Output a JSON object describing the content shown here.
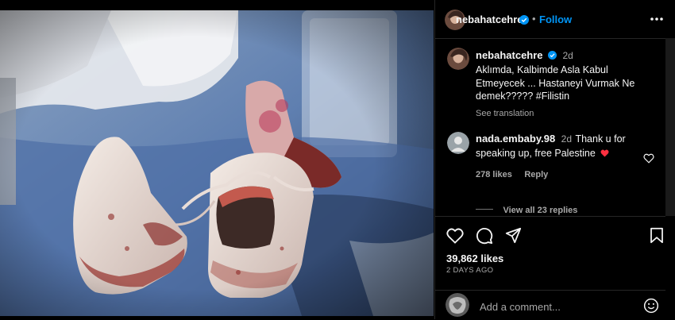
{
  "post": {
    "author": "nebahatcehre",
    "follow_label": "Follow",
    "separator": "•",
    "more_icon": "more-horizontal-icon"
  },
  "caption": {
    "username": "nebahatcehre",
    "time": "2d",
    "text": "Aklımda, Kalbimde Asla Kabul Etmeyecek ... Hastaneyi Vurmak Ne demek????? #Filistin",
    "see_translation": "See translation"
  },
  "comment": {
    "username": "nada.embaby.98",
    "time": "2d",
    "text": "Thank u for speaking up, free Palestine",
    "likes": "278 likes",
    "reply": "Reply",
    "view_replies": "View all 23 replies"
  },
  "actions": {
    "likes": "39,862 likes",
    "date": "2 DAYS AGO",
    "add_comment_placeholder": "Add a comment...",
    "icons": [
      "heart-icon",
      "comment-icon",
      "share-icon",
      "save-icon",
      "emoji-icon"
    ]
  },
  "colors": {
    "accent": "#0095f6",
    "heart": "#ff3040",
    "background": "#000000"
  }
}
